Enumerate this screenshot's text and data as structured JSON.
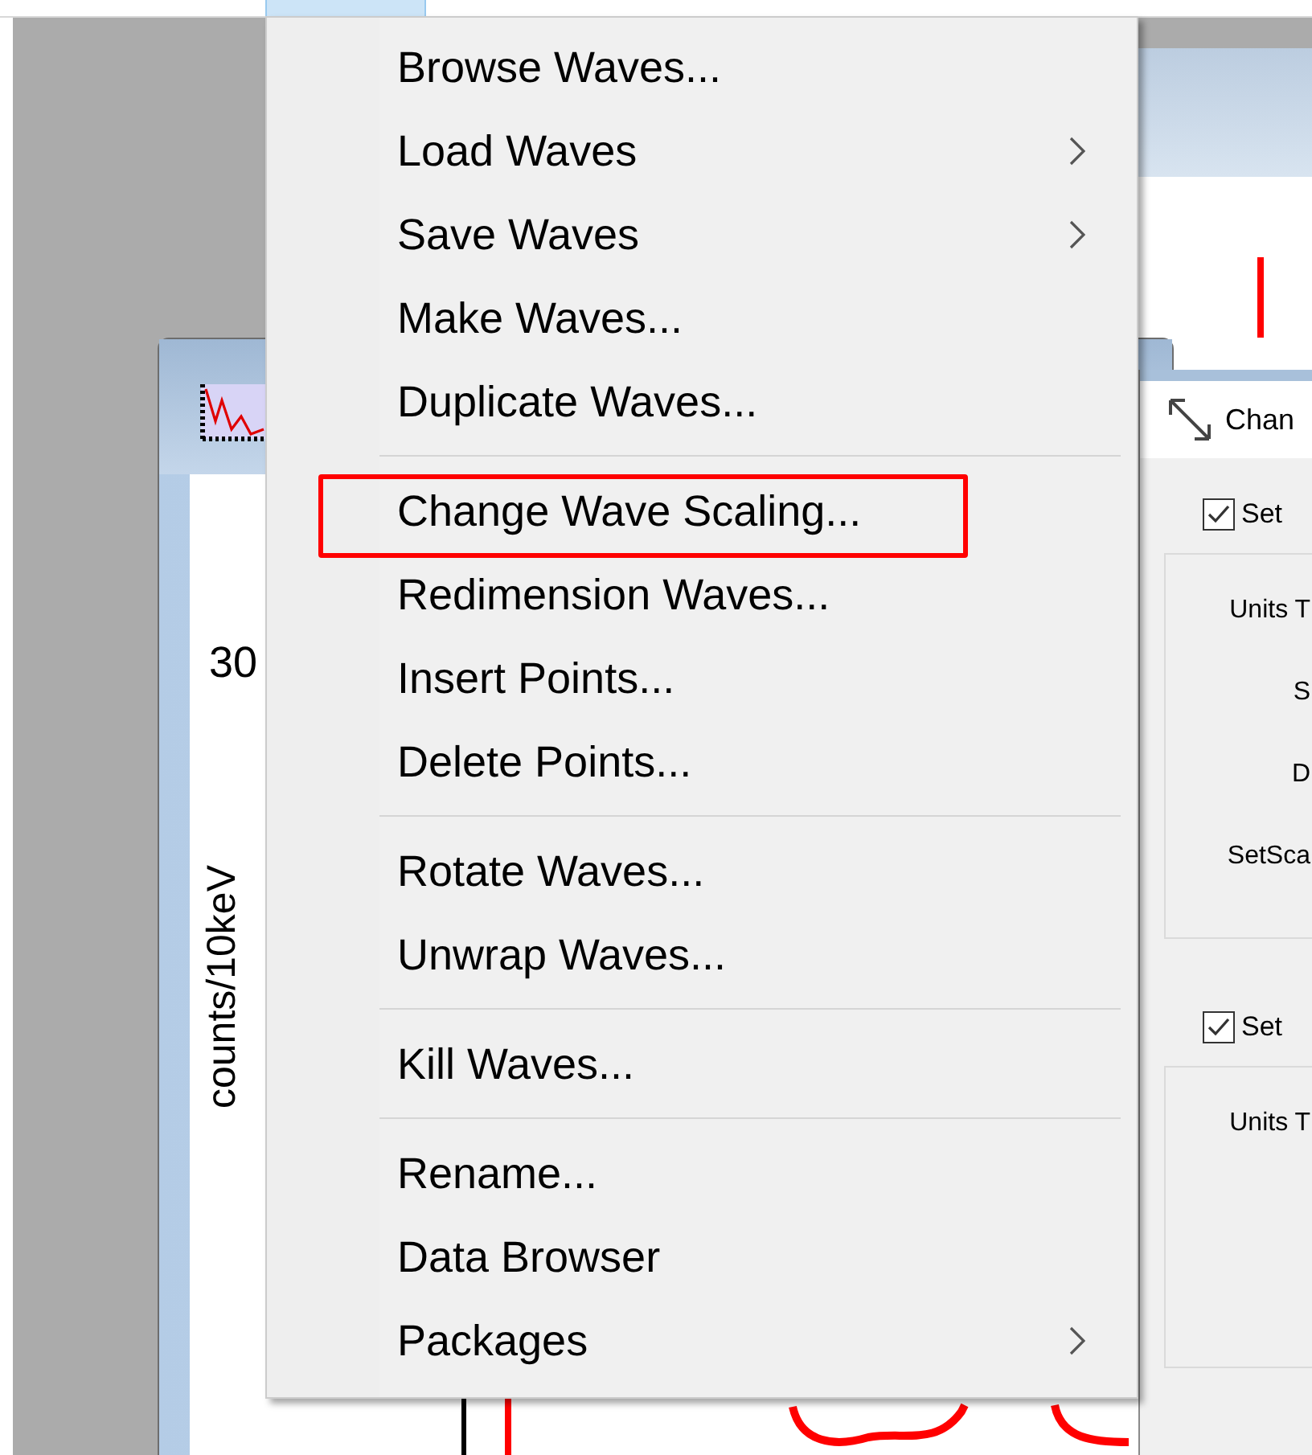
{
  "back_window": {
    "has_spike": true
  },
  "graph_window": {
    "axis_value": "30",
    "axis_label": "counts/10keV"
  },
  "dialog": {
    "title": "Chan",
    "sections": [
      {
        "checkbox": {
          "label": "Set",
          "checked": true
        },
        "labels": [
          "Units T",
          "S",
          "D",
          "SetSca"
        ]
      },
      {
        "checkbox": {
          "label": "Set",
          "checked": true
        },
        "labels": [
          "Units T"
        ]
      }
    ]
  },
  "menu": {
    "groups": [
      {
        "items": [
          {
            "label": "Browse Waves...",
            "submenu": false,
            "highlighted": false
          },
          {
            "label": "Load Waves",
            "submenu": true,
            "highlighted": false
          },
          {
            "label": "Save Waves",
            "submenu": true,
            "highlighted": false
          },
          {
            "label": "Make Waves...",
            "submenu": false,
            "highlighted": false
          },
          {
            "label": "Duplicate Waves...",
            "submenu": false,
            "highlighted": false
          }
        ]
      },
      {
        "items": [
          {
            "label": "Change Wave Scaling...",
            "submenu": false,
            "highlighted": true
          },
          {
            "label": "Redimension Waves...",
            "submenu": false,
            "highlighted": false
          },
          {
            "label": "Insert Points...",
            "submenu": false,
            "highlighted": false
          },
          {
            "label": "Delete Points...",
            "submenu": false,
            "highlighted": false
          }
        ]
      },
      {
        "items": [
          {
            "label": "Rotate Waves...",
            "submenu": false,
            "highlighted": false
          },
          {
            "label": "Unwrap Waves...",
            "submenu": false,
            "highlighted": false
          }
        ]
      },
      {
        "items": [
          {
            "label": "Kill Waves...",
            "submenu": false,
            "highlighted": false
          }
        ]
      },
      {
        "items": [
          {
            "label": "Rename...",
            "submenu": false,
            "highlighted": false
          },
          {
            "label": "Data Browser",
            "submenu": false,
            "highlighted": false
          },
          {
            "label": "Packages",
            "submenu": true,
            "highlighted": false
          }
        ]
      }
    ]
  }
}
